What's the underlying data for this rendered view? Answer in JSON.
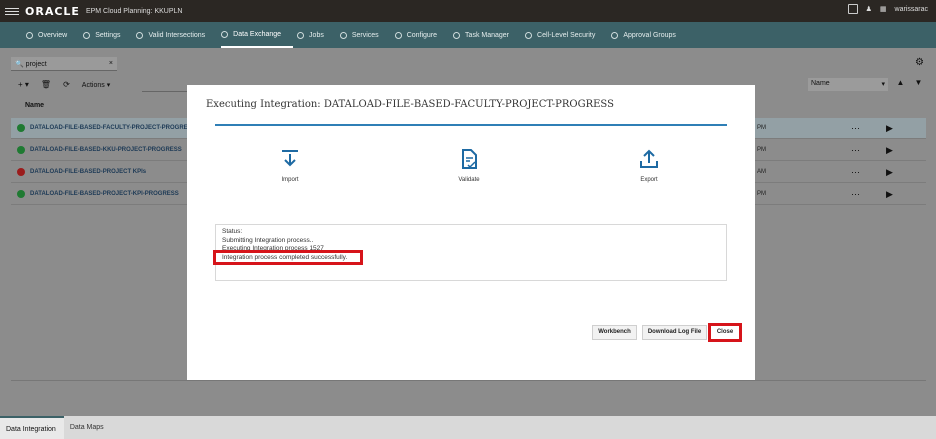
{
  "header": {
    "brand": "ORACLE",
    "app": "EPM Cloud Planning:",
    "instance": "KKUPLN",
    "user": "warissarac"
  },
  "tabs": [
    {
      "label": "Overview",
      "icon": "globe-icon"
    },
    {
      "label": "Settings",
      "icon": "gear-icon"
    },
    {
      "label": "Valid Intersections",
      "icon": "intersection-icon"
    },
    {
      "label": "Data Exchange",
      "icon": "exchange-icon",
      "active": true
    },
    {
      "label": "Jobs",
      "icon": "calendar-icon"
    },
    {
      "label": "Services",
      "icon": "camera-icon"
    },
    {
      "label": "Configure",
      "icon": "wrench-icon"
    },
    {
      "label": "Task Manager",
      "icon": "tasks-icon"
    },
    {
      "label": "Cell-Level Security",
      "icon": "grid-lock-icon"
    },
    {
      "label": "Approval Groups",
      "icon": "approval-icon"
    }
  ],
  "search": {
    "value": "project"
  },
  "toolbar": {
    "actions_label": "Actions"
  },
  "sort": {
    "label": "Name"
  },
  "table": {
    "column": "Name",
    "rows": [
      {
        "name": "DATALOAD-FILE-BASED-FACULTY-PROJECT-PROGRESS",
        "status": "success",
        "time": "PM"
      },
      {
        "name": "DATALOAD-FILE-BASED-KKU-PROJECT-PROGRESS",
        "status": "success",
        "time": "PM"
      },
      {
        "name": "DATALOAD-FILE-BASED-PROJECT KPIs",
        "status": "error",
        "time": "AM"
      },
      {
        "name": "DATALOAD-FILE-BASED-PROJECT-KPI-PROGRESS",
        "status": "success",
        "time": "PM"
      }
    ]
  },
  "modal": {
    "title": "Executing Integration: DATALOAD-FILE-BASED-FACULTY-PROJECT-PROGRESS",
    "steps": [
      {
        "label": "Import",
        "icon": "import-icon"
      },
      {
        "label": "Validate",
        "icon": "validate-icon"
      },
      {
        "label": "Export",
        "icon": "export-icon"
      }
    ],
    "status_label": "Status:",
    "status_lines": [
      "Submitting Integration process..",
      "Executing Integration process 1527",
      "Integration process completed successfully."
    ],
    "buttons": {
      "workbench": "Workbench",
      "download": "Download Log File",
      "close": "Close"
    }
  },
  "bottom_tabs": [
    {
      "label": "Data Integration",
      "active": true
    },
    {
      "label": "Data Maps"
    }
  ],
  "colors": {
    "tabbar": "#3c6167",
    "accent": "#2f7fb6",
    "highlight": "#d6141a"
  }
}
